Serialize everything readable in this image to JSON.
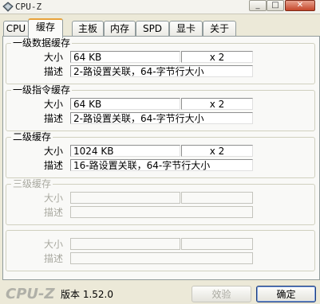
{
  "window": {
    "title": "CPU-Z",
    "minimize": "_",
    "maximize": "□",
    "close": "✕"
  },
  "tabs": [
    {
      "label": "CPU"
    },
    {
      "label": "缓存"
    },
    {
      "label": "主板"
    },
    {
      "label": "内存"
    },
    {
      "label": "SPD"
    },
    {
      "label": "显卡"
    },
    {
      "label": "关于"
    }
  ],
  "active_tab": "缓存",
  "l1d": {
    "title": "一级数据缓存",
    "size_label": "大小",
    "size": "64 KB",
    "count": "x 2",
    "desc_label": "描述",
    "desc": "2-路设置关联，64-字节行大小"
  },
  "l1i": {
    "title": "一级指令缓存",
    "size_label": "大小",
    "size": "64 KB",
    "count": "x 2",
    "desc_label": "描述",
    "desc": "2-路设置关联，64-字节行大小"
  },
  "l2": {
    "title": "二级缓存",
    "size_label": "大小",
    "size": "1024 KB",
    "count": "x 2",
    "desc_label": "描述",
    "desc": "16-路设置关联，64-字节行大小"
  },
  "l3": {
    "title": "三级缓存",
    "size_label": "大小",
    "desc_label": "描述"
  },
  "extra": {
    "size_label": "大小",
    "desc_label": "描述"
  },
  "footer": {
    "logo": "CPU-Z",
    "version": "版本 1.52.0",
    "validate": "效验",
    "ok": "确定"
  }
}
